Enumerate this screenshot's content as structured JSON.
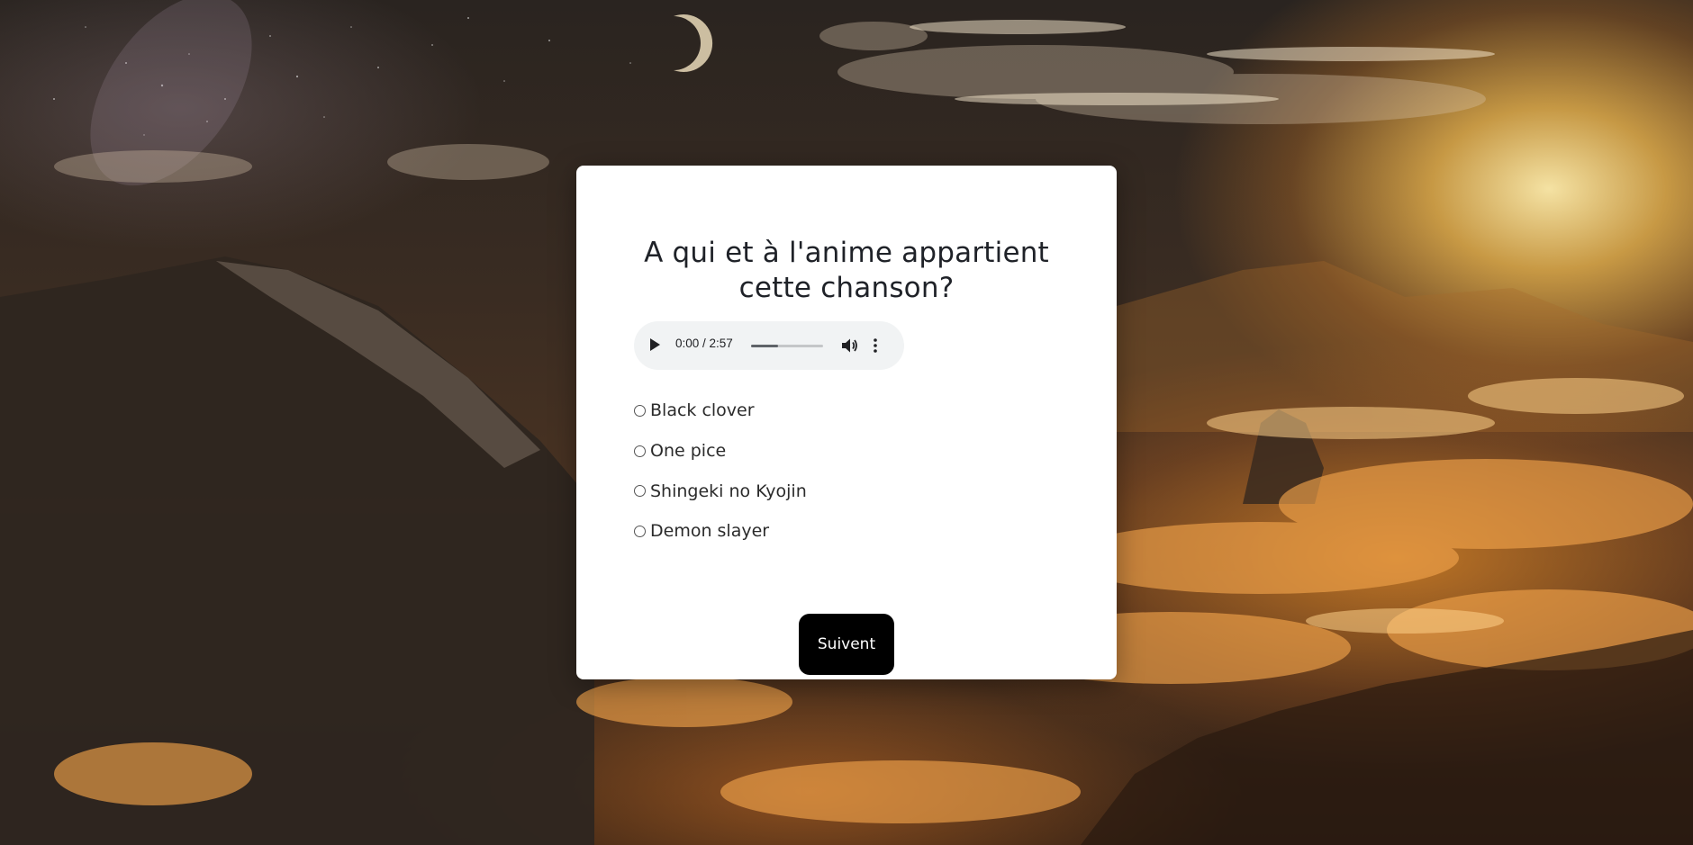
{
  "quiz": {
    "question": "A qui et à l'anime appartient cette chanson?",
    "audio": {
      "time": "0:00 / 2:57",
      "buffered_fraction": 0.38
    },
    "options": [
      {
        "label": "Black clover"
      },
      {
        "label": "One pice"
      },
      {
        "label": "Shingeki no Kyojin"
      },
      {
        "label": "Demon slayer"
      }
    ],
    "next_label": "Suivent"
  },
  "icons": {
    "play": "play-icon",
    "volume": "volume-icon",
    "more": "more-vertical-icon",
    "radio": "radio-unchecked-icon"
  },
  "colors": {
    "button_bg": "#000000",
    "card_bg": "#ffffff",
    "audio_bg": "#f1f3f4",
    "text": "#1f2228"
  }
}
